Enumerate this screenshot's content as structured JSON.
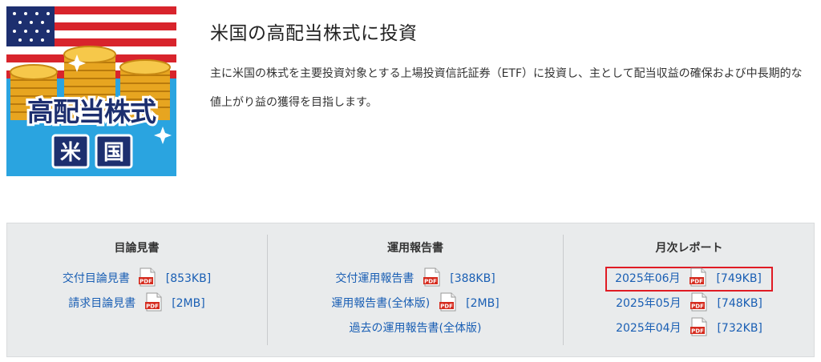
{
  "fund": {
    "image_text_main": "高配当株式",
    "image_text_sub_1": "米",
    "image_text_sub_2": "国",
    "title": "米国の高配当株式に投資",
    "description": "主に米国の株式を主要投資対象とする上場投資信託証券（ETF）に投資し、主として配当収益の確保および中長期的な値上がり益の獲得を目指します。"
  },
  "colors": {
    "link": "#1a5fb4",
    "highlight": "#e01b24",
    "panel_bg": "#e9ebec",
    "pdf_red": "#d52b1e"
  },
  "pdf_icon_label": "PDF",
  "documents": {
    "prospectus": {
      "title": "目論見書",
      "items": [
        {
          "label": "交付目論見書",
          "size": "[853KB]"
        },
        {
          "label": "請求目論見書",
          "size": "[2MB]"
        }
      ]
    },
    "reports": {
      "title": "運用報告書",
      "items": [
        {
          "label": "交付運用報告書",
          "size": "[388KB]"
        },
        {
          "label": "運用報告書(全体版)",
          "size": "[2MB]"
        },
        {
          "label": "過去の運用報告書(全体版)",
          "size": ""
        }
      ]
    },
    "monthly": {
      "title": "月次レポート",
      "items": [
        {
          "label": "2025年06月",
          "size": "[749KB]",
          "highlighted": true
        },
        {
          "label": "2025年05月",
          "size": "[748KB]"
        },
        {
          "label": "2025年04月",
          "size": "[732KB]"
        }
      ]
    }
  }
}
